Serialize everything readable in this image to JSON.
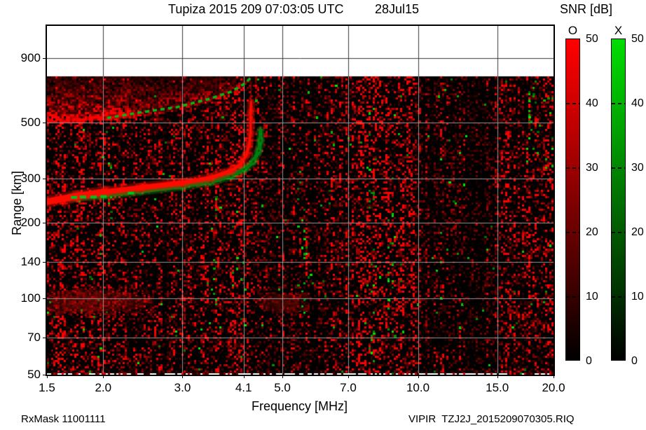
{
  "title": {
    "main": "Tupiza 2015 209 07:03:05 UTC",
    "date": "28Jul15"
  },
  "colorbar": {
    "title": "SNR [dB]",
    "bars": [
      {
        "label": "O",
        "top_color": "#ff0000"
      },
      {
        "label": "X",
        "top_color": "#00dd00"
      }
    ],
    "ticks": [
      {
        "v": 50,
        "label": "50"
      },
      {
        "v": 40,
        "label": "40"
      },
      {
        "v": 30,
        "label": "30"
      },
      {
        "v": 20,
        "label": "20"
      },
      {
        "v": 10,
        "label": "10"
      },
      {
        "v": 0,
        "label": "0"
      }
    ]
  },
  "axes": {
    "x_label": "Frequency [MHz]",
    "y_label": "Range [km]",
    "x_ticks": [
      {
        "f": 1.5,
        "label": "1.5"
      },
      {
        "f": 2.0,
        "label": "2.0"
      },
      {
        "f": 3.0,
        "label": "3.0"
      },
      {
        "f": 4.1,
        "label": "4.1"
      },
      {
        "f": 5.0,
        "label": "5.0"
      },
      {
        "f": 7.0,
        "label": "7.0"
      },
      {
        "f": 10.0,
        "label": "10.0"
      },
      {
        "f": 15.0,
        "label": "15.0"
      },
      {
        "f": 20.0,
        "label": "20.0"
      }
    ],
    "y_ticks": [
      {
        "r": 900,
        "label": "900"
      },
      {
        "r": 500,
        "label": "500"
      },
      {
        "r": 300,
        "label": "300"
      },
      {
        "r": 200,
        "label": "200"
      },
      {
        "r": 140,
        "label": "140"
      },
      {
        "r": 100,
        "label": "100"
      },
      {
        "r": 70,
        "label": "70"
      },
      {
        "r": 50,
        "label": "50"
      }
    ]
  },
  "footer": {
    "left": "RxMask 11001111",
    "right": "VIPIR  TZJ2J_2015209070305.RIQ"
  },
  "chart_data": {
    "type": "heatmap",
    "title": "Tupiza 2015 209 07:03:05 UTC  28Jul15",
    "xlabel": "Frequency [MHz]",
    "ylabel": "Range [km]",
    "x_axis": {
      "scale": "log",
      "min": 1.5,
      "max": 20,
      "ticks": [
        1.5,
        2.0,
        3.0,
        4.1,
        5.0,
        7.0,
        10.0,
        15.0,
        20.0
      ]
    },
    "y_axis": {
      "scale": "log",
      "min": 50,
      "max": 1204,
      "ticks": [
        900,
        500,
        300,
        200,
        140,
        100,
        70,
        50
      ]
    },
    "data_top_range_km": 760,
    "colorbar": {
      "label": "SNR [dB]",
      "min": 0,
      "max": 50,
      "ticks": [
        50,
        40,
        30,
        20,
        10,
        0
      ],
      "polarizations": [
        "O",
        "X"
      ]
    },
    "series": [
      {
        "name": "O-mode F-layer trace",
        "color": "#ff0800",
        "points": [
          [
            1.5,
            242
          ],
          [
            1.75,
            255
          ],
          [
            2.02,
            265
          ],
          [
            2.42,
            275
          ],
          [
            3.0,
            288
          ],
          [
            3.46,
            301
          ],
          [
            3.85,
            321
          ],
          [
            4.05,
            343
          ],
          [
            4.16,
            372
          ],
          [
            4.22,
            410
          ],
          [
            4.25,
            452
          ],
          [
            4.25,
            547
          ],
          [
            4.26,
            602
          ]
        ]
      },
      {
        "name": "X-mode F-layer trace",
        "color": "#00cc22",
        "points": [
          [
            1.69,
            251
          ],
          [
            2.02,
            257
          ],
          [
            2.42,
            267
          ],
          [
            3.0,
            279
          ],
          [
            3.46,
            290
          ],
          [
            3.85,
            307
          ],
          [
            4.13,
            327
          ],
          [
            4.31,
            349
          ],
          [
            4.43,
            385
          ],
          [
            4.47,
            423
          ],
          [
            4.47,
            466
          ]
        ]
      },
      {
        "name": "second-hop X trace",
        "color": "#00bb22",
        "points": [
          [
            2.04,
            520
          ],
          [
            2.42,
            547
          ],
          [
            2.93,
            575
          ],
          [
            3.46,
            621
          ],
          [
            3.85,
            661
          ],
          [
            4.13,
            713
          ],
          [
            4.25,
            750
          ]
        ]
      }
    ],
    "spread_band": {
      "lower_edge": [
        [
          1.5,
          498
        ],
        [
          1.69,
          505
        ],
        [
          2.02,
          512
        ],
        [
          2.42,
          530
        ],
        [
          2.93,
          560
        ],
        [
          3.46,
          610
        ],
        [
          3.85,
          655
        ],
        [
          4.13,
          705
        ],
        [
          4.27,
          758
        ]
      ],
      "top_km": 760,
      "f_end": 4.3
    },
    "e_region_patches": [
      {
        "f": [
          1.52,
          2.6
        ],
        "r": [
          87,
          110
        ],
        "strength": 0.6
      },
      {
        "f": [
          4.6,
          5.65
        ],
        "r": [
          88,
          106
        ],
        "strength": 0.42
      }
    ],
    "green_noise_columns": [
      {
        "f": [
          2.03,
          2.13
        ],
        "r": [
          210,
          620
        ]
      },
      {
        "f": [
          3.44,
          3.58
        ],
        "r": [
          80,
          307
        ]
      },
      {
        "f": [
          3.86,
          3.98
        ],
        "r": [
          103,
          238
        ]
      },
      {
        "f": [
          5.38,
          5.62
        ],
        "r": [
          85,
          423
        ]
      },
      {
        "f": [
          7.78,
          8.02
        ],
        "r": [
          51,
          755
        ]
      },
      {
        "f": [
          8.55,
          8.92
        ],
        "r": [
          50,
          225
        ]
      },
      {
        "f": [
          17.4,
          20.0
        ],
        "r": [
          320,
          760
        ]
      }
    ],
    "red_column_zones": [
      [
        1.5,
        2.4,
        1.15
      ],
      [
        2.4,
        4.4,
        1.0
      ],
      [
        4.4,
        5.6,
        0.7
      ],
      [
        5.6,
        6.9,
        0.85
      ],
      [
        6.9,
        9.6,
        1.55
      ],
      [
        9.6,
        10.6,
        0.95
      ],
      [
        10.6,
        14.5,
        0.6
      ],
      [
        14.5,
        17.0,
        0.9
      ],
      [
        17.0,
        20.0,
        1.0
      ]
    ],
    "dark_stripes": [
      [
        2.7,
        2.8,
        0.35
      ],
      [
        5.75,
        5.95,
        0.45
      ],
      [
        10.25,
        10.8,
        0.45
      ]
    ]
  }
}
